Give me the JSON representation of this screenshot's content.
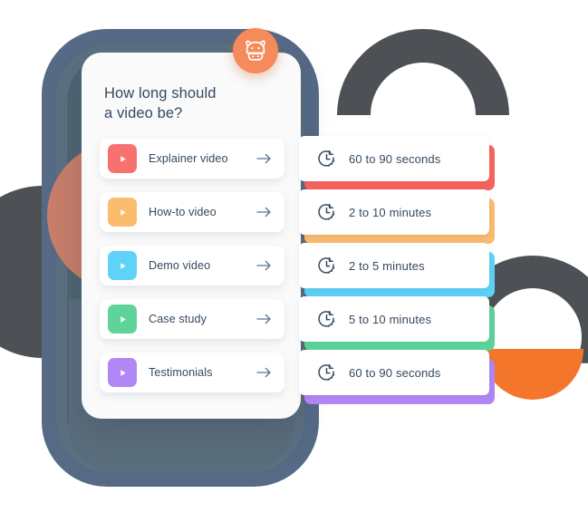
{
  "illustration": {
    "title_line_1": "How long should",
    "title_line_2": "a video be?",
    "brand_badge_icon": "hippo-mascot-icon",
    "colors": {
      "badge": "#f58a5a",
      "plate": "#566a86",
      "dark_arc": "#4d5155",
      "orange_disc": "#f4762b",
      "text": "#35495e",
      "card": "#ffffff"
    }
  },
  "video_types": [
    {
      "label": "Explainer video",
      "color": "#f9716f",
      "icon": "play-icon",
      "arrow": "arrow-right-icon"
    },
    {
      "label": "How-to video",
      "color": "#fbbc6d",
      "icon": "play-icon",
      "arrow": "arrow-right-icon"
    },
    {
      "label": "Demo video",
      "color": "#5ed2f7",
      "icon": "play-icon",
      "arrow": "arrow-right-icon"
    },
    {
      "label": "Case study",
      "color": "#5ed49a",
      "icon": "play-icon",
      "arrow": "arrow-right-icon"
    },
    {
      "label": "Testimonials",
      "color": "#b186f5",
      "icon": "play-icon",
      "arrow": "arrow-right-icon"
    }
  ],
  "durations": [
    {
      "label": "60 to 90 seconds",
      "color": "#f9635d",
      "icon": "clock-icon"
    },
    {
      "label": "2 to 10 minutes",
      "color": "#fbbc6d",
      "icon": "clock-icon"
    },
    {
      "label": "2 to 5 minutes",
      "color": "#5ed2f7",
      "icon": "clock-icon"
    },
    {
      "label": "5 to 10 minutes",
      "color": "#5ed49a",
      "icon": "clock-icon"
    },
    {
      "label": "60 to 90 seconds",
      "color": "#b186f5",
      "icon": "clock-icon"
    }
  ]
}
